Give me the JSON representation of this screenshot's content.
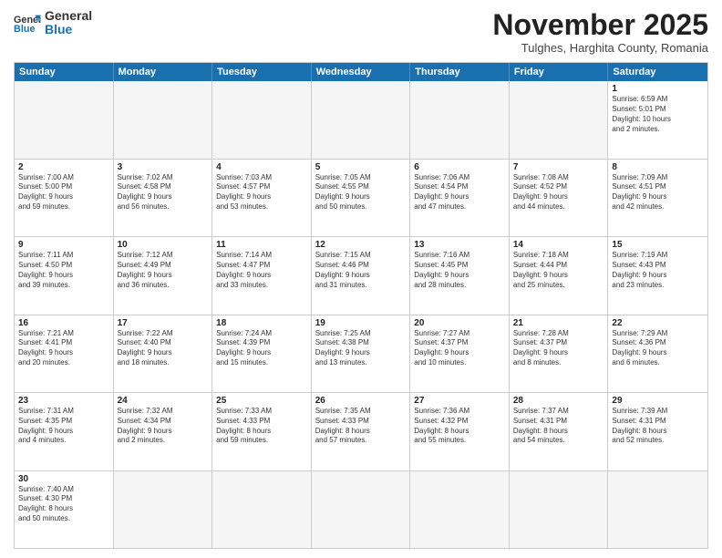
{
  "logo": {
    "text_general": "General",
    "text_blue": "Blue"
  },
  "header": {
    "month": "November 2025",
    "location": "Tulghes, Harghita County, Romania"
  },
  "days_of_week": [
    "Sunday",
    "Monday",
    "Tuesday",
    "Wednesday",
    "Thursday",
    "Friday",
    "Saturday"
  ],
  "weeks": [
    [
      {
        "day": "",
        "content": "",
        "empty": true
      },
      {
        "day": "",
        "content": "",
        "empty": true
      },
      {
        "day": "",
        "content": "",
        "empty": true
      },
      {
        "day": "",
        "content": "",
        "empty": true
      },
      {
        "day": "",
        "content": "",
        "empty": true
      },
      {
        "day": "",
        "content": "",
        "empty": true
      },
      {
        "day": "1",
        "content": "Sunrise: 6:59 AM\nSunset: 5:01 PM\nDaylight: 10 hours\nand 2 minutes."
      }
    ],
    [
      {
        "day": "2",
        "content": "Sunrise: 7:00 AM\nSunset: 5:00 PM\nDaylight: 9 hours\nand 59 minutes."
      },
      {
        "day": "3",
        "content": "Sunrise: 7:02 AM\nSunset: 4:58 PM\nDaylight: 9 hours\nand 56 minutes."
      },
      {
        "day": "4",
        "content": "Sunrise: 7:03 AM\nSunset: 4:57 PM\nDaylight: 9 hours\nand 53 minutes."
      },
      {
        "day": "5",
        "content": "Sunrise: 7:05 AM\nSunset: 4:55 PM\nDaylight: 9 hours\nand 50 minutes."
      },
      {
        "day": "6",
        "content": "Sunrise: 7:06 AM\nSunset: 4:54 PM\nDaylight: 9 hours\nand 47 minutes."
      },
      {
        "day": "7",
        "content": "Sunrise: 7:08 AM\nSunset: 4:52 PM\nDaylight: 9 hours\nand 44 minutes."
      },
      {
        "day": "8",
        "content": "Sunrise: 7:09 AM\nSunset: 4:51 PM\nDaylight: 9 hours\nand 42 minutes."
      }
    ],
    [
      {
        "day": "9",
        "content": "Sunrise: 7:11 AM\nSunset: 4:50 PM\nDaylight: 9 hours\nand 39 minutes."
      },
      {
        "day": "10",
        "content": "Sunrise: 7:12 AM\nSunset: 4:49 PM\nDaylight: 9 hours\nand 36 minutes."
      },
      {
        "day": "11",
        "content": "Sunrise: 7:14 AM\nSunset: 4:47 PM\nDaylight: 9 hours\nand 33 minutes."
      },
      {
        "day": "12",
        "content": "Sunrise: 7:15 AM\nSunset: 4:46 PM\nDaylight: 9 hours\nand 31 minutes."
      },
      {
        "day": "13",
        "content": "Sunrise: 7:16 AM\nSunset: 4:45 PM\nDaylight: 9 hours\nand 28 minutes."
      },
      {
        "day": "14",
        "content": "Sunrise: 7:18 AM\nSunset: 4:44 PM\nDaylight: 9 hours\nand 25 minutes."
      },
      {
        "day": "15",
        "content": "Sunrise: 7:19 AM\nSunset: 4:43 PM\nDaylight: 9 hours\nand 23 minutes."
      }
    ],
    [
      {
        "day": "16",
        "content": "Sunrise: 7:21 AM\nSunset: 4:41 PM\nDaylight: 9 hours\nand 20 minutes."
      },
      {
        "day": "17",
        "content": "Sunrise: 7:22 AM\nSunset: 4:40 PM\nDaylight: 9 hours\nand 18 minutes."
      },
      {
        "day": "18",
        "content": "Sunrise: 7:24 AM\nSunset: 4:39 PM\nDaylight: 9 hours\nand 15 minutes."
      },
      {
        "day": "19",
        "content": "Sunrise: 7:25 AM\nSunset: 4:38 PM\nDaylight: 9 hours\nand 13 minutes."
      },
      {
        "day": "20",
        "content": "Sunrise: 7:27 AM\nSunset: 4:37 PM\nDaylight: 9 hours\nand 10 minutes."
      },
      {
        "day": "21",
        "content": "Sunrise: 7:28 AM\nSunset: 4:37 PM\nDaylight: 9 hours\nand 8 minutes."
      },
      {
        "day": "22",
        "content": "Sunrise: 7:29 AM\nSunset: 4:36 PM\nDaylight: 9 hours\nand 6 minutes."
      }
    ],
    [
      {
        "day": "23",
        "content": "Sunrise: 7:31 AM\nSunset: 4:35 PM\nDaylight: 9 hours\nand 4 minutes."
      },
      {
        "day": "24",
        "content": "Sunrise: 7:32 AM\nSunset: 4:34 PM\nDaylight: 9 hours\nand 2 minutes."
      },
      {
        "day": "25",
        "content": "Sunrise: 7:33 AM\nSunset: 4:33 PM\nDaylight: 8 hours\nand 59 minutes."
      },
      {
        "day": "26",
        "content": "Sunrise: 7:35 AM\nSunset: 4:33 PM\nDaylight: 8 hours\nand 57 minutes."
      },
      {
        "day": "27",
        "content": "Sunrise: 7:36 AM\nSunset: 4:32 PM\nDaylight: 8 hours\nand 55 minutes."
      },
      {
        "day": "28",
        "content": "Sunrise: 7:37 AM\nSunset: 4:31 PM\nDaylight: 8 hours\nand 54 minutes."
      },
      {
        "day": "29",
        "content": "Sunrise: 7:39 AM\nSunset: 4:31 PM\nDaylight: 8 hours\nand 52 minutes."
      }
    ],
    [
      {
        "day": "30",
        "content": "Sunrise: 7:40 AM\nSunset: 4:30 PM\nDaylight: 8 hours\nand 50 minutes."
      },
      {
        "day": "",
        "content": "",
        "empty": true
      },
      {
        "day": "",
        "content": "",
        "empty": true
      },
      {
        "day": "",
        "content": "",
        "empty": true
      },
      {
        "day": "",
        "content": "",
        "empty": true
      },
      {
        "day": "",
        "content": "",
        "empty": true
      },
      {
        "day": "",
        "content": "",
        "empty": true
      }
    ]
  ]
}
